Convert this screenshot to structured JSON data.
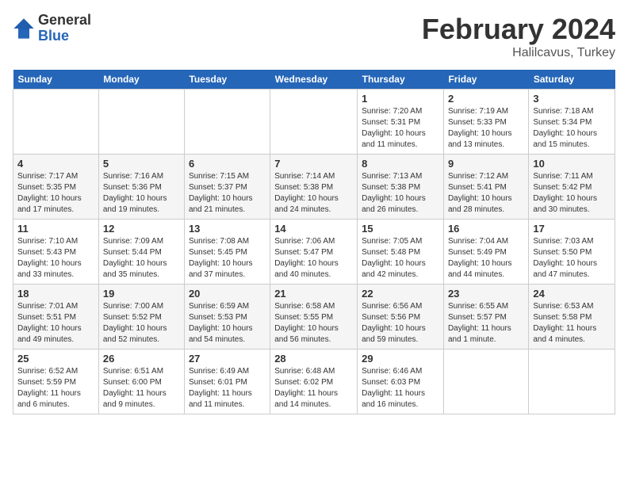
{
  "logo": {
    "general": "General",
    "blue": "Blue"
  },
  "header": {
    "month": "February 2024",
    "location": "Halilcavus, Turkey"
  },
  "weekdays": [
    "Sunday",
    "Monday",
    "Tuesday",
    "Wednesday",
    "Thursday",
    "Friday",
    "Saturday"
  ],
  "weeks": [
    [
      {
        "day": "",
        "info": ""
      },
      {
        "day": "",
        "info": ""
      },
      {
        "day": "",
        "info": ""
      },
      {
        "day": "",
        "info": ""
      },
      {
        "day": "1",
        "info": "Sunrise: 7:20 AM\nSunset: 5:31 PM\nDaylight: 10 hours\nand 11 minutes."
      },
      {
        "day": "2",
        "info": "Sunrise: 7:19 AM\nSunset: 5:33 PM\nDaylight: 10 hours\nand 13 minutes."
      },
      {
        "day": "3",
        "info": "Sunrise: 7:18 AM\nSunset: 5:34 PM\nDaylight: 10 hours\nand 15 minutes."
      }
    ],
    [
      {
        "day": "4",
        "info": "Sunrise: 7:17 AM\nSunset: 5:35 PM\nDaylight: 10 hours\nand 17 minutes."
      },
      {
        "day": "5",
        "info": "Sunrise: 7:16 AM\nSunset: 5:36 PM\nDaylight: 10 hours\nand 19 minutes."
      },
      {
        "day": "6",
        "info": "Sunrise: 7:15 AM\nSunset: 5:37 PM\nDaylight: 10 hours\nand 21 minutes."
      },
      {
        "day": "7",
        "info": "Sunrise: 7:14 AM\nSunset: 5:38 PM\nDaylight: 10 hours\nand 24 minutes."
      },
      {
        "day": "8",
        "info": "Sunrise: 7:13 AM\nSunset: 5:38 PM\nDaylight: 10 hours\nand 26 minutes."
      },
      {
        "day": "9",
        "info": "Sunrise: 7:12 AM\nSunset: 5:41 PM\nDaylight: 10 hours\nand 28 minutes."
      },
      {
        "day": "10",
        "info": "Sunrise: 7:11 AM\nSunset: 5:42 PM\nDaylight: 10 hours\nand 30 minutes."
      }
    ],
    [
      {
        "day": "11",
        "info": "Sunrise: 7:10 AM\nSunset: 5:43 PM\nDaylight: 10 hours\nand 33 minutes."
      },
      {
        "day": "12",
        "info": "Sunrise: 7:09 AM\nSunset: 5:44 PM\nDaylight: 10 hours\nand 35 minutes."
      },
      {
        "day": "13",
        "info": "Sunrise: 7:08 AM\nSunset: 5:45 PM\nDaylight: 10 hours\nand 37 minutes."
      },
      {
        "day": "14",
        "info": "Sunrise: 7:06 AM\nSunset: 5:47 PM\nDaylight: 10 hours\nand 40 minutes."
      },
      {
        "day": "15",
        "info": "Sunrise: 7:05 AM\nSunset: 5:48 PM\nDaylight: 10 hours\nand 42 minutes."
      },
      {
        "day": "16",
        "info": "Sunrise: 7:04 AM\nSunset: 5:49 PM\nDaylight: 10 hours\nand 44 minutes."
      },
      {
        "day": "17",
        "info": "Sunrise: 7:03 AM\nSunset: 5:50 PM\nDaylight: 10 hours\nand 47 minutes."
      }
    ],
    [
      {
        "day": "18",
        "info": "Sunrise: 7:01 AM\nSunset: 5:51 PM\nDaylight: 10 hours\nand 49 minutes."
      },
      {
        "day": "19",
        "info": "Sunrise: 7:00 AM\nSunset: 5:52 PM\nDaylight: 10 hours\nand 52 minutes."
      },
      {
        "day": "20",
        "info": "Sunrise: 6:59 AM\nSunset: 5:53 PM\nDaylight: 10 hours\nand 54 minutes."
      },
      {
        "day": "21",
        "info": "Sunrise: 6:58 AM\nSunset: 5:55 PM\nDaylight: 10 hours\nand 56 minutes."
      },
      {
        "day": "22",
        "info": "Sunrise: 6:56 AM\nSunset: 5:56 PM\nDaylight: 10 hours\nand 59 minutes."
      },
      {
        "day": "23",
        "info": "Sunrise: 6:55 AM\nSunset: 5:57 PM\nDaylight: 11 hours\nand 1 minute."
      },
      {
        "day": "24",
        "info": "Sunrise: 6:53 AM\nSunset: 5:58 PM\nDaylight: 11 hours\nand 4 minutes."
      }
    ],
    [
      {
        "day": "25",
        "info": "Sunrise: 6:52 AM\nSunset: 5:59 PM\nDaylight: 11 hours\nand 6 minutes."
      },
      {
        "day": "26",
        "info": "Sunrise: 6:51 AM\nSunset: 6:00 PM\nDaylight: 11 hours\nand 9 minutes."
      },
      {
        "day": "27",
        "info": "Sunrise: 6:49 AM\nSunset: 6:01 PM\nDaylight: 11 hours\nand 11 minutes."
      },
      {
        "day": "28",
        "info": "Sunrise: 6:48 AM\nSunset: 6:02 PM\nDaylight: 11 hours\nand 14 minutes."
      },
      {
        "day": "29",
        "info": "Sunrise: 6:46 AM\nSunset: 6:03 PM\nDaylight: 11 hours\nand 16 minutes."
      },
      {
        "day": "",
        "info": ""
      },
      {
        "day": "",
        "info": ""
      }
    ]
  ]
}
